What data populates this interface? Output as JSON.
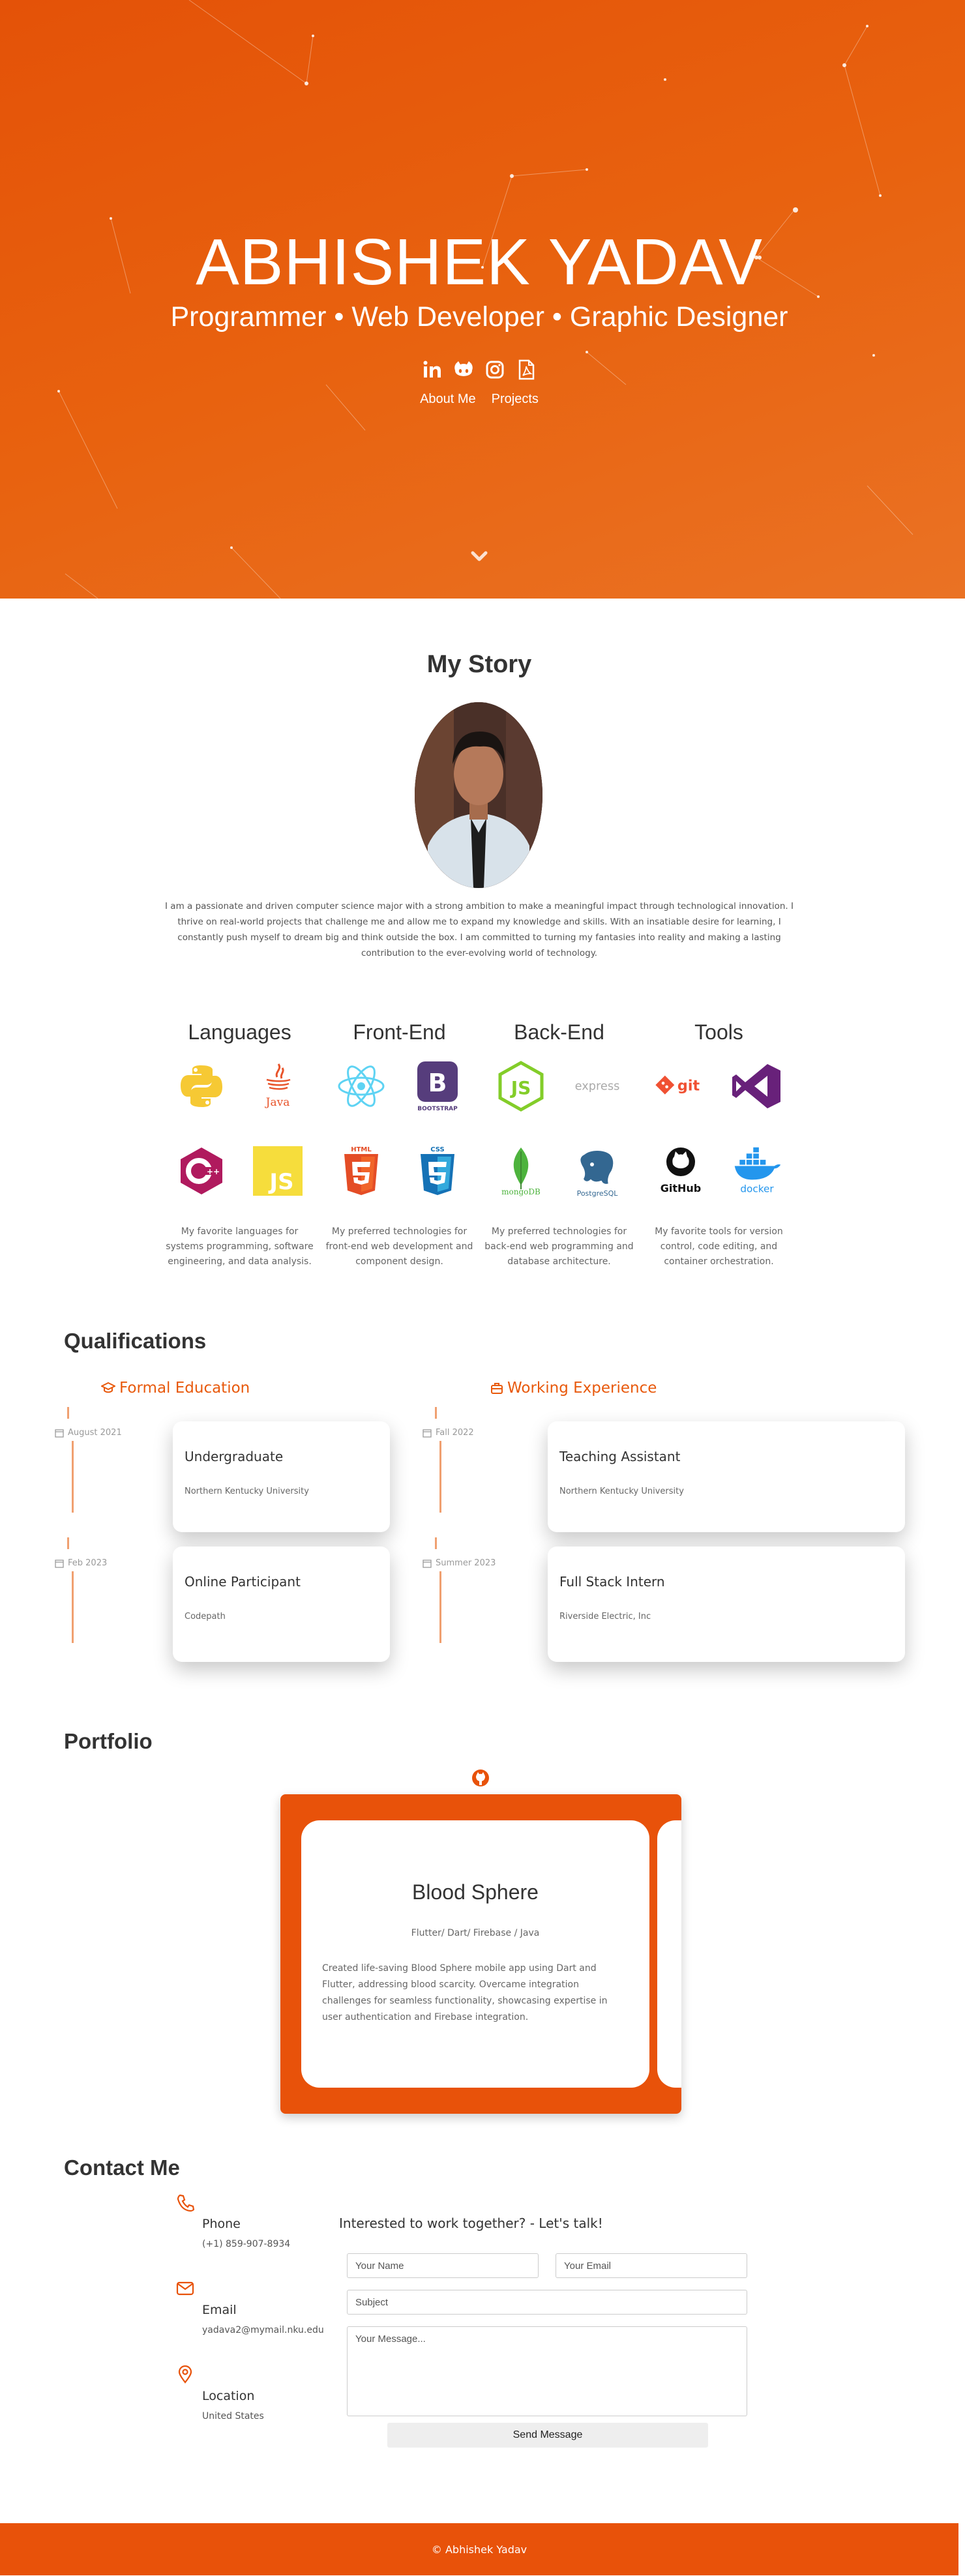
{
  "hero": {
    "name": "ABHISHEK YADAV",
    "subtitle": "Programmer • Web Developer • Graphic Designer",
    "social_icons": [
      "linkedin-icon",
      "github-icon",
      "instagram-icon",
      "pdf-resume-icon"
    ],
    "nav": [
      "About Me",
      "Projects"
    ],
    "scroll_icon": "chevron-down-icon"
  },
  "story": {
    "title": "My Story",
    "text": "I am a passionate and driven computer science major with a strong ambition to make a meaningful impact through technological innovation. I thrive on real-world projects that challenge me and allow me to expand my knowledge and skills. With an insatiable desire for learning, I constantly push myself to dream big and think outside the box. I am committed to turning my fantasies into reality and making a lasting contribution to the ever-evolving world of technology."
  },
  "skills": [
    {
      "title": "Languages",
      "logos": [
        "python-logo",
        "java-logo",
        "cpp-logo",
        "javascript-logo"
      ],
      "desc": "My favorite languages for systems programming, software engineering, and data analysis."
    },
    {
      "title": "Front-End",
      "logos": [
        "react-logo",
        "bootstrap-logo",
        "html5-logo",
        "css3-logo"
      ],
      "desc": "My preferred technologies for front-end web development and component design."
    },
    {
      "title": "Back-End",
      "logos": [
        "nodejs-logo",
        "express-logo",
        "mongodb-logo",
        "postgresql-logo"
      ],
      "desc": "My preferred technologies for back-end web programming and database architecture."
    },
    {
      "title": "Tools",
      "logos": [
        "git-logo",
        "visual-studio-logo",
        "github-logo",
        "docker-logo"
      ],
      "desc": "My favorite tools for version control, code editing, and container orchestration."
    }
  ],
  "logo_text": {
    "java": "Java",
    "bootstrap": "BOOTSTRAP",
    "express": "express",
    "git": "git",
    "mongodb": "mongoDB",
    "postgresql": "PostgreSQL",
    "github": "GitHub",
    "docker": "docker",
    "html": "HTML",
    "css": "CSS",
    "js": "JS"
  },
  "qualifications": {
    "title": "Qualifications",
    "education_label": "Formal Education",
    "work_label": "Working Experience",
    "education": [
      {
        "date": "August 2021",
        "title": "Undergraduate",
        "org": "Northern Kentucky University"
      },
      {
        "date": "Feb 2023",
        "title": "Online Participant",
        "org": "Codepath"
      }
    ],
    "work": [
      {
        "date": "Fall 2022",
        "title": "Teaching Assistant",
        "org": "Northern Kentucky University"
      },
      {
        "date": "Summer 2023",
        "title": "Full Stack Intern",
        "org": "Riverside Electric, Inc"
      }
    ]
  },
  "portfolio": {
    "title": "Portfolio",
    "project": {
      "name": "Blood Sphere",
      "tech": "Flutter/ Dart/ Firebase / Java",
      "desc": "Created life-saving Blood Sphere mobile app using Dart and Flutter, addressing blood scarcity. Overcame integration challenges for seamless functionality, showcasing expertise in user authentication and Firebase integration."
    }
  },
  "contact": {
    "title": "Contact Me",
    "phone_label": "Phone",
    "phone": "(+1) 859-907-8934",
    "email_label": "Email",
    "email": "yadava2@mymail.nku.edu",
    "location_label": "Location",
    "location": "United States",
    "cta": "Interested to work together? - Let's talk!",
    "name_placeholder": "Your Name",
    "email_placeholder": "Your Email",
    "subject_placeholder": "Subject",
    "message_placeholder": "Your Message...",
    "send_label": "Send Message"
  },
  "footer": {
    "text": "© Abhishek Yadav"
  },
  "colors": {
    "accent": "#e8520a",
    "hero_start": "#e45208",
    "hero_end": "#ea7224"
  }
}
